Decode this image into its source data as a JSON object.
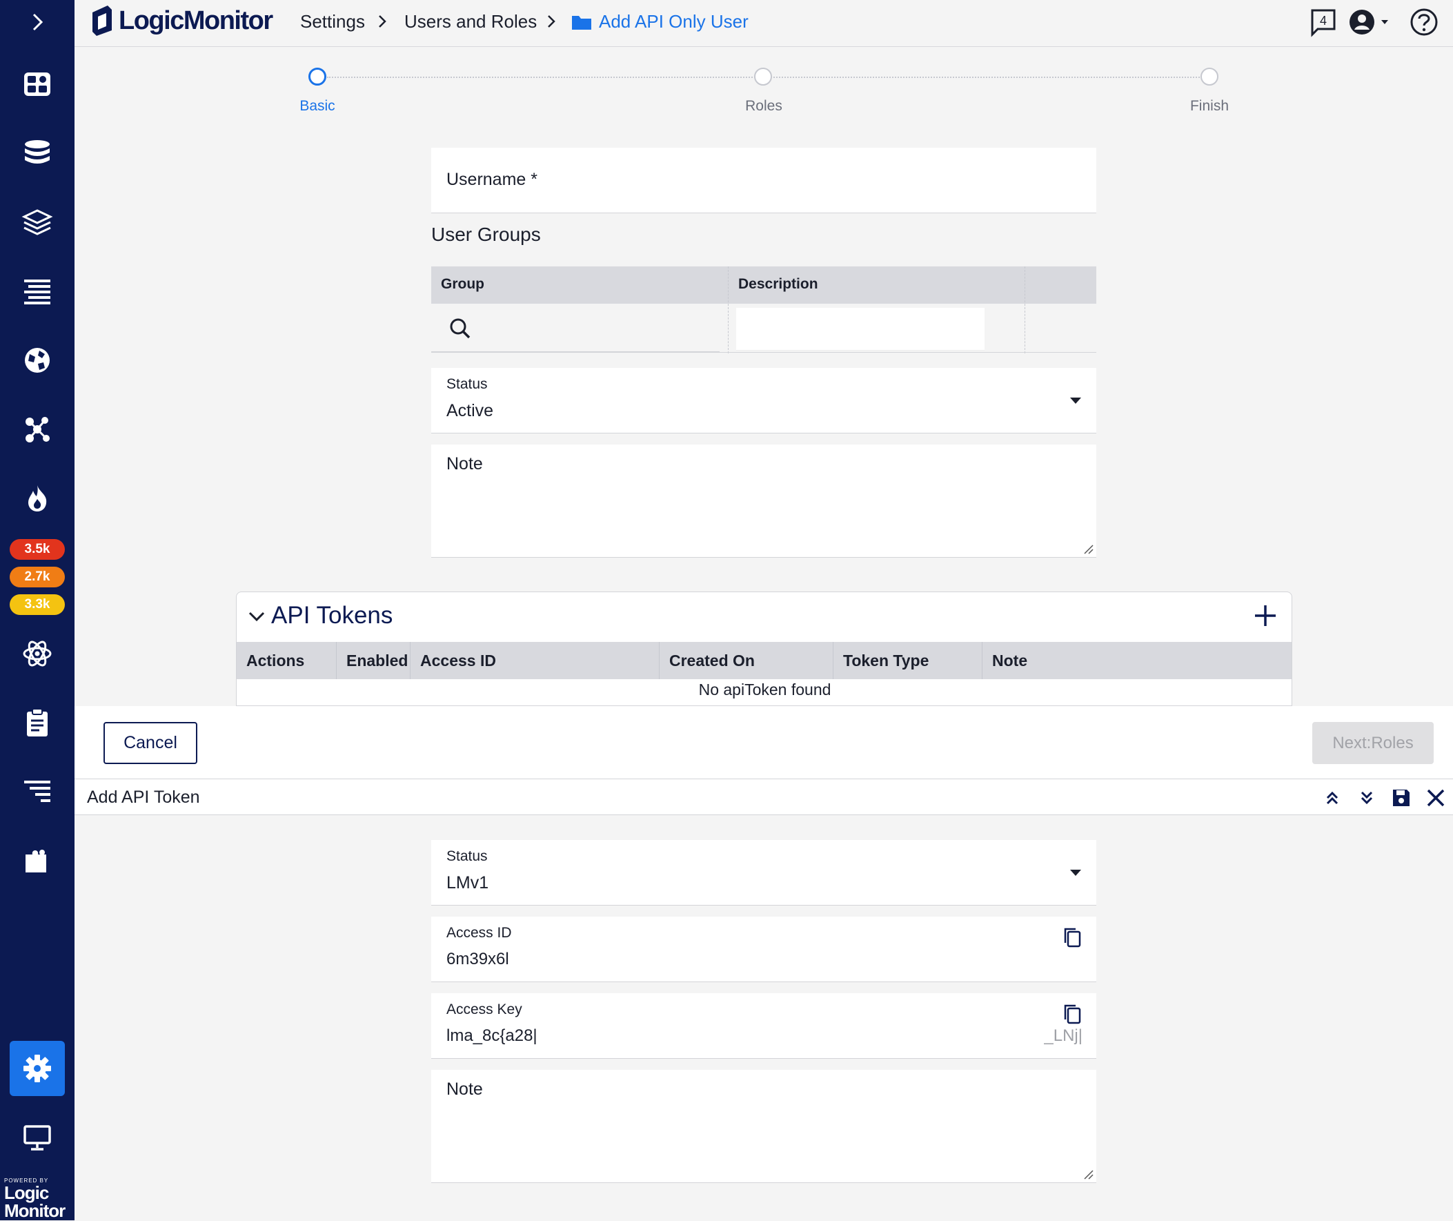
{
  "app": {
    "brand": "LogicMonitor",
    "powered_by": "POWERED BY",
    "powered_logo_line1": "Logic",
    "powered_logo_line2": "Monitor"
  },
  "breadcrumb": {
    "items": [
      "Settings",
      "Users and Roles"
    ],
    "current": "Add API Only User"
  },
  "header": {
    "notifications_count": "4"
  },
  "sidebar": {
    "badges": [
      {
        "label": "3.5k",
        "color": "#e2341d"
      },
      {
        "label": "2.7k",
        "color": "#f07d15"
      },
      {
        "label": "3.3k",
        "color": "#f4c311"
      }
    ]
  },
  "stepper": {
    "steps": [
      "Basic",
      "Roles",
      "Finish"
    ],
    "active_index": 0
  },
  "form": {
    "username_label": "Username *",
    "user_groups_title": "User Groups",
    "group_col": "Group",
    "description_col": "Description",
    "status_label": "Status",
    "status_value": "Active",
    "note_label": "Note"
  },
  "api_tokens": {
    "title": "API Tokens",
    "columns": [
      "Actions",
      "Enabled",
      "Access ID",
      "Created On",
      "Token Type",
      "Note"
    ],
    "empty_message": "No apiToken found"
  },
  "actions": {
    "cancel": "Cancel",
    "next": "Next:Roles"
  },
  "drawer": {
    "title": "Add API Token",
    "status_label": "Status",
    "status_value": "LMv1",
    "access_id_label": "Access ID",
    "access_id_value": "6m39x6l",
    "access_key_label": "Access Key",
    "access_key_value": "lma_8c{a28|",
    "access_key_tail": "_LNj|",
    "note_label": "Note"
  },
  "colors": {
    "sidebar_bg": "#0c1a52",
    "accent": "#1a73e8"
  }
}
